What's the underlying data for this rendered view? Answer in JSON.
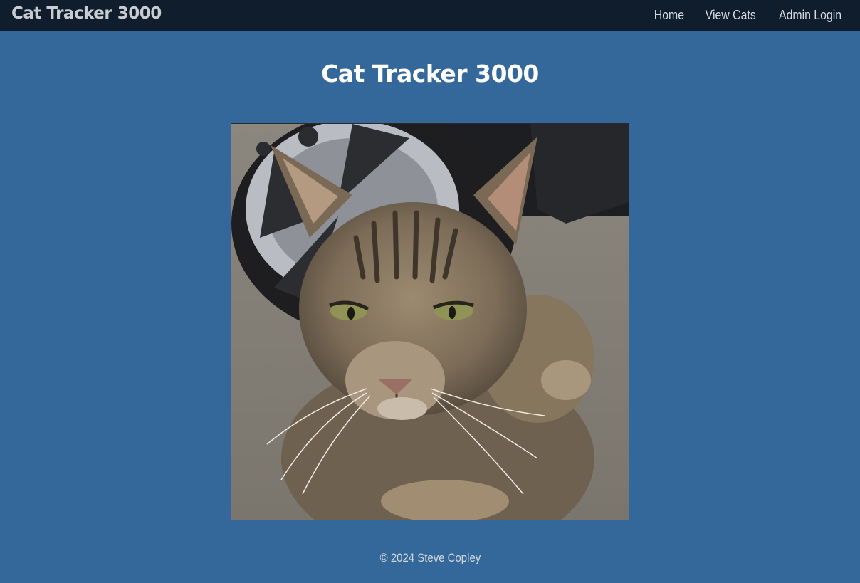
{
  "navbar": {
    "brand": "Cat Tracker 3000",
    "links": [
      {
        "label": "Home"
      },
      {
        "label": "View Cats"
      },
      {
        "label": "Admin Login"
      }
    ]
  },
  "main": {
    "title": "Cat Tracker 3000",
    "photo_alt": "Tabby cat lying on pavement next to a car wheel"
  },
  "footer": {
    "copyright": "© 2024 Steve Copley"
  },
  "colors": {
    "background": "#35689a",
    "navbar": "#0f1d2c",
    "brand_text": "#c9ccd0",
    "title_text": "#ffffff"
  }
}
